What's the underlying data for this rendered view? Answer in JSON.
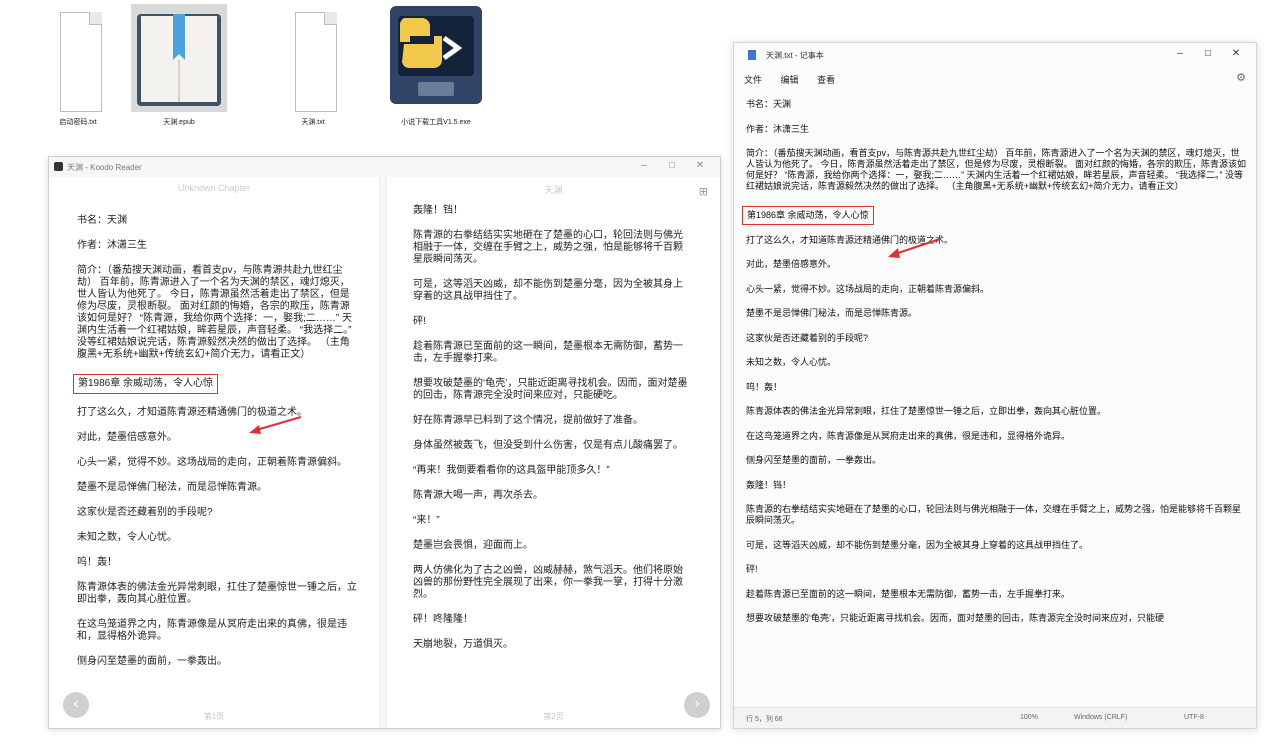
{
  "desktop": {
    "files": [
      {
        "name": "启动密码.txt"
      },
      {
        "name": "天渊.epub"
      },
      {
        "name": "天渊.txt"
      },
      {
        "name": "小说下载工具V1.5.exe"
      }
    ]
  },
  "koodo": {
    "title": "天渊 - Koodo Reader",
    "left_header": "Unknown Chapter",
    "right_header": "天渊",
    "left_page_no": "第1页",
    "right_page_no": "第2页",
    "left_paragraphs": [
      "书名：天渊",
      "作者：沐潇三生",
      "简介：（番茄搜天渊动画，看首支pv，与陈青源共赴九世红尘劫） 百年前，陈青源进入了一个名为天渊的禁区，魂灯熄灭，世人皆认为他死了。 今日，陈青源虽然活着走出了禁区，但是修为尽废，灵根断裂。 面对红颜的悔婚，各宗的欺压，陈青源该如何是好？ “陈青源，我给你两个选择：一，娶我;二……” 天渊内生活着一个红裙姑娘，眸若星辰，声音轻柔。 “我选择二。” 没等红裙姑娘说完话，陈青源毅然决然的做出了选择。 （主角腹黑+无系统+幽默+传统玄幻+简介无力，请看正文）",
      "第1986章 余威动荡，令人心惊",
      "打了这么久，才知道陈青源还精通佛门的极道之术。",
      "对此，楚墨倍感意外。",
      "心头一紧，觉得不妙。这场战局的走向，正朝着陈青源偏斜。",
      "楚墨不是忌惮佛门秘法，而是忌惮陈青源。",
      "这家伙是否还藏着别的手段呢?",
      "未知之数，令人心忧。",
      "呜！轰！",
      "陈青源体表的佛法金光异常刺眼，扛住了楚墨惊世一锤之后，立即出拳，轰向其心脏位置。",
      "在这鸟笼道界之内，陈青源像是从冥府走出来的真佛，很是违和，显得格外诡异。",
      "侧身闪至楚墨的面前，一拳轰出。"
    ],
    "right_paragraphs": [
      "轰隆！铛！",
      "陈青源的右拳结结实实地砸在了楚墨的心口，轮回法则与佛光相融于一体，交缠在手臂之上，威势之强，怕是能够将千百颗星辰瞬间荡灭。",
      "可是，这等滔天凶威，却不能伤到楚墨分毫，因为全被其身上穿着的这具战甲挡住了。",
      "砰!",
      "趁着陈青源已至面前的这一瞬间，楚墨根本无需防御，蓄势一击，左手握拳打来。",
      "想要攻破楚墨的‘龟壳’，只能近距离寻找机会。因而，面对楚墨的回击，陈青源完全没时间来应对，只能硬吃。",
      "好在陈青源早已料到了这个情况，提前做好了准备。",
      "身体虽然被轰飞，但没受到什么伤害，仅是有点儿酸痛罢了。",
      "“再来！我倒要看看你的这具盔甲能顶多久！”",
      "陈青源大喝一声，再次杀去。",
      "“来！”",
      "楚墨岂会畏惧，迎面而上。",
      "两人仿佛化为了古之凶兽，凶威赫赫，煞气滔天。他们将原始凶兽的那份野性完全展现了出来，你一拳我一掌，打得十分激烈。",
      "砰！咚隆隆！",
      "天崩地裂，万道俱灭。"
    ]
  },
  "notepad": {
    "title": "天渊.txt - 记事本",
    "menu": [
      "文件",
      "编辑",
      "查看"
    ],
    "paragraphs": [
      "书名：天渊",
      "作者：沐潇三生",
      "简介：（番茄搜天渊动画，看首支pv，与陈青源共赴九世红尘劫） 百年前，陈青源进入了一个名为天渊的禁区，魂灯熄灭，世人皆认为他死了。 今日，陈青源虽然活着走出了禁区，但是修为尽废，灵根断裂。 面对红颜的悔婚，各宗的欺压，陈青源该如何是好？ “陈青源，我给你两个选择：一，娶我;二……” 天渊内生活着一个红裙姑娘，眸若星辰，声音轻柔。 “我选择二。” 没等红裙姑娘说完话，陈青源毅然决然的做出了选择。 （主角腹黑+无系统+幽默+传统玄幻+简介无力，请看正文）",
      "第1986章 余威动荡，令人心惊",
      "打了这么久，才知道陈青源还精通佛门的极道之术。",
      "对此，楚墨倍感意外。",
      "心头一紧，觉得不妙。这场战局的走向，正朝着陈青源偏斜。",
      "楚墨不是忌惮佛门秘法，而是忌惮陈青源。",
      "这家伙是否还藏着别的手段呢?",
      "未知之数，令人心忧。",
      "呜！轰！",
      "陈青源体表的佛法金光异常刺眼，扛住了楚墨惊世一锤之后，立即出拳，轰向其心脏位置。",
      "在这鸟笼道界之内，陈青源像是从冥府走出来的真佛，很是违和，显得格外诡异。",
      "侧身闪至楚墨的面前，一拳轰出。",
      "轰隆！铛！",
      "陈青源的右拳结结实实地砸在了楚墨的心口，轮回法则与佛光相融于一体，交缠在手臂之上，威势之强，怕是能够将千百颗星辰瞬间荡灭。",
      "可是，这等滔天凶威，却不能伤到楚墨分毫，因为全被其身上穿着的这具战甲挡住了。",
      "砰!",
      "趁着陈青源已至面前的这一瞬间，楚墨根本无需防御，蓄势一击，左手握拳打来。",
      "想要攻破楚墨的‘龟壳’，只能近距离寻找机会。因而，面对楚墨的回击，陈青源完全没时间来应对，只能硬"
    ],
    "status": {
      "position": "行 5，列 66",
      "zoom": "100%",
      "line_ending": "Windows (CRLF)",
      "encoding": "UTF-8"
    }
  }
}
